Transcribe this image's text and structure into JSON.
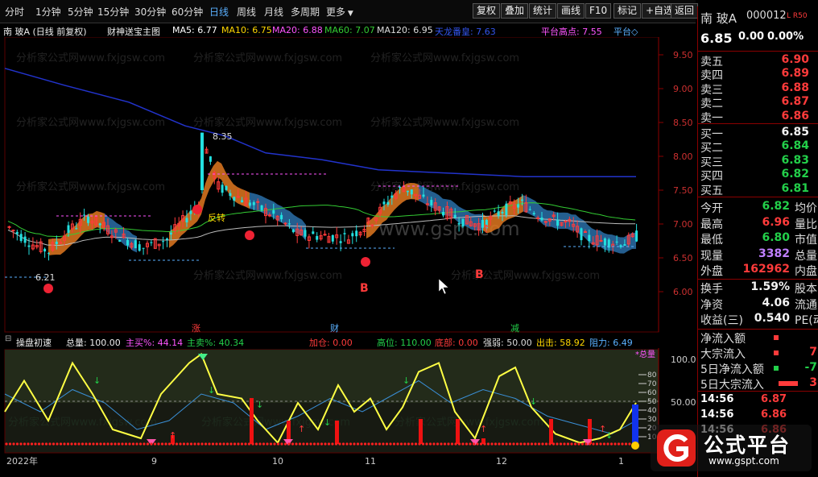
{
  "periods": [
    "分时",
    "1分钟",
    "5分钟",
    "15分钟",
    "30分钟",
    "60分钟",
    "日线",
    "周线",
    "月线",
    "多周期",
    "更多"
  ],
  "tools": [
    "复权",
    "叠加",
    "统计",
    "画线",
    "F10",
    "标记",
    "+自选",
    "返回"
  ],
  "legend": {
    "title": "南 玻A (日线 前复权)",
    "indicator": "财神送宝主图",
    "ma5": "MA5: 6.77",
    "ma10": "MA10: 6.75",
    "ma20": "MA20: 6.88",
    "ma60": "MA60: 7.07",
    "ma120": "MA120: 6.95",
    "tianlong": "天龙番皇: 7.63",
    "platform": "平台高点: 7.55",
    "platform2": "平台◇"
  },
  "price_axis": [
    "9.50",
    "9.00",
    "8.50",
    "8.00",
    "7.50",
    "7.00",
    "6.50",
    "6.00"
  ],
  "annotations": {
    "high": "8.35",
    "low": "6.21",
    "reverse": "反转",
    "b1": "B",
    "b2": "B",
    "zhang": "涨",
    "cai": "财",
    "jian": "减"
  },
  "ind_legend": {
    "name": "操盘初速",
    "total": "总量: 100.00",
    "main_buy": "主买%: 44.14",
    "main_sell": "主卖%: 40.34",
    "add": "加仓: 0.00",
    "high": "高位: 110.00",
    "bottom": "底部: 0.00",
    "strength": "强弱: 50.00",
    "exit": "出击: 58.92",
    "resist": "阻力: 6.49"
  },
  "ind_axis": [
    "100.0",
    "50.00"
  ],
  "ind_right": {
    "tag": "*总量",
    "ticks": [
      "80",
      "70",
      "60",
      "50",
      "40",
      "30",
      "20",
      "10"
    ]
  },
  "dates": [
    "2022年",
    "9",
    "10",
    "11",
    "12",
    "1"
  ],
  "stock": {
    "name": "南 玻A",
    "code": "000012",
    "badge": "L R50",
    "price": "6.85",
    "change": "0.00",
    "pct": "0.00%"
  },
  "asks": [
    {
      "label": "卖五",
      "price": "6.90"
    },
    {
      "label": "卖四",
      "price": "6.89"
    },
    {
      "label": "卖三",
      "price": "6.88"
    },
    {
      "label": "卖二",
      "price": "6.87"
    },
    {
      "label": "卖一",
      "price": "6.86"
    }
  ],
  "bids": [
    {
      "label": "买一",
      "price": "6.85"
    },
    {
      "label": "买二",
      "price": "6.84"
    },
    {
      "label": "买三",
      "price": "6.83"
    },
    {
      "label": "买四",
      "price": "6.82"
    },
    {
      "label": "买五",
      "price": "6.81"
    }
  ],
  "stats": [
    {
      "label": "今开",
      "value": "6.82",
      "side": "均价"
    },
    {
      "label": "最高",
      "value": "6.96",
      "side": "量比"
    },
    {
      "label": "最低",
      "value": "6.80",
      "side": "市值"
    },
    {
      "label": "现量",
      "value": "3382",
      "side": "总量"
    },
    {
      "label": "外盘",
      "value": "162962",
      "side": "内盘"
    }
  ],
  "stats2": [
    {
      "label": "换手",
      "value": "1.59%",
      "side": "股本"
    },
    {
      "label": "净资",
      "value": "4.06",
      "side": "流通"
    },
    {
      "label": "收益(三)",
      "value": "0.540",
      "side": "PE(动"
    }
  ],
  "flows": [
    {
      "label": "净流入额",
      "value": "",
      "v2": ""
    },
    {
      "label": "大宗流入",
      "value": "",
      "v2": "7"
    },
    {
      "label": "5日净流入额",
      "value": "",
      "v2": "-7"
    },
    {
      "label": "5日大宗流入",
      "value": "",
      "v2": "3"
    }
  ],
  "ticks_list": [
    {
      "time": "14:56",
      "price": "6.87"
    },
    {
      "time": "14:56",
      "price": "6.86"
    },
    {
      "time": "14:56",
      "price": "6.86"
    }
  ],
  "watermark": "分析家公式网www.fxjgsw.com",
  "site": "www.gspt.com",
  "logo": {
    "title": "公式平台",
    "url": "www.gspt.com"
  },
  "colors": {
    "up": "#ff3b3b",
    "down": "#23d04a",
    "ma5": "#ffffff",
    "ma10": "#ffd700",
    "ma20": "#ff55ff",
    "ma60": "#33cc33",
    "ma120": "#cccccc",
    "tianlong": "#2233cc"
  }
}
